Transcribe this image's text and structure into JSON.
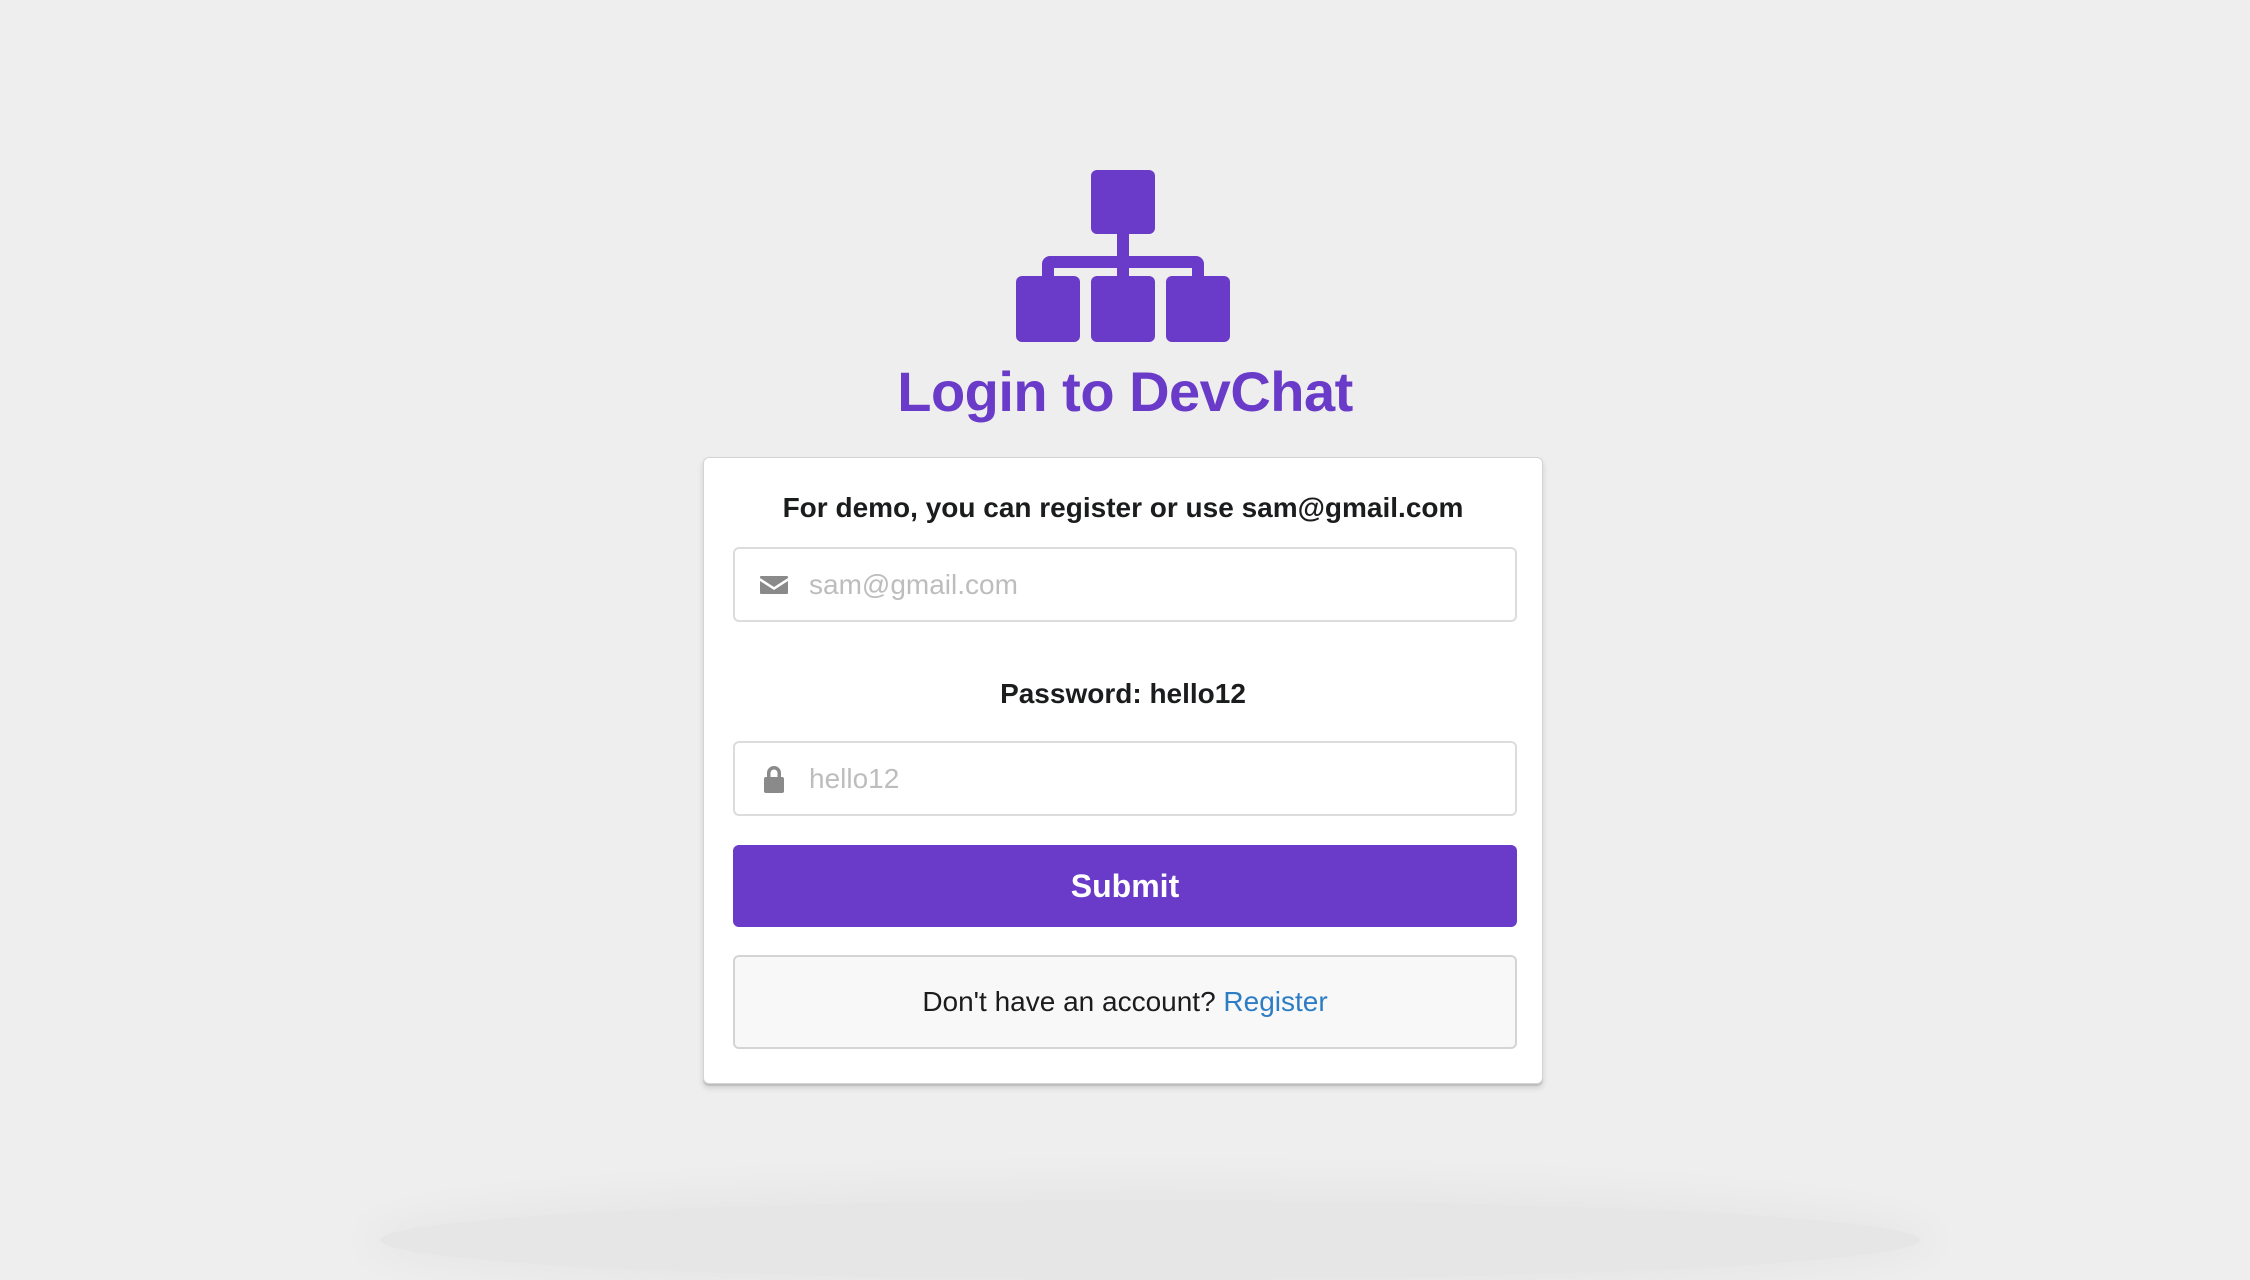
{
  "header": {
    "logo_icon": "sitemap-icon",
    "title": "Login to DevChat"
  },
  "form": {
    "demo_text": "For demo, you can register or use sam@gmail.com",
    "email": {
      "icon": "mail-icon",
      "placeholder": "sam@gmail.com",
      "value": ""
    },
    "password_label": "Password: hello12",
    "password": {
      "icon": "lock-icon",
      "placeholder": "hello12",
      "value": ""
    },
    "submit_label": "Submit"
  },
  "register": {
    "prompt": "Don't have an account? ",
    "link_label": "Register"
  },
  "colors": {
    "accent": "#6a3bc8",
    "link": "#2d7dc4",
    "background": "#eeeeee"
  }
}
